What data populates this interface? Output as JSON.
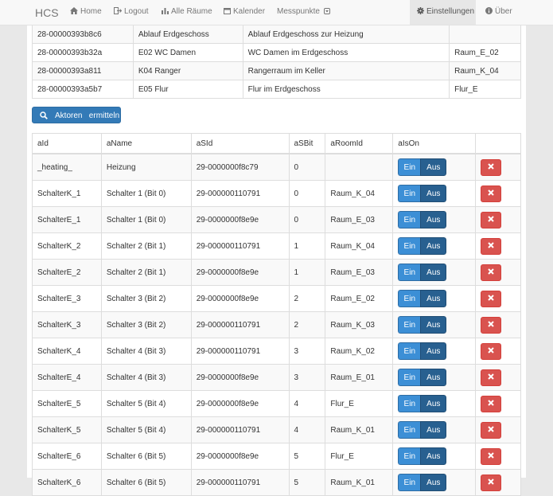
{
  "navbar": {
    "brand": "HCS",
    "items": [
      {
        "label": "Home",
        "icon": "home-icon"
      },
      {
        "label": "Logout",
        "icon": "logout-icon"
      },
      {
        "label": "Alle Räume",
        "icon": "bar-chart-icon"
      },
      {
        "label": "Kalender",
        "icon": "calendar-icon"
      },
      {
        "label": "Messpunkte",
        "icon": "caret-down-icon"
      }
    ],
    "right_items": [
      {
        "label": "Einstellungen",
        "icon": "gear-icon",
        "active": true
      },
      {
        "label": "Über",
        "icon": "info-icon"
      }
    ]
  },
  "sensors": [
    {
      "id": "28-00000393b8c6",
      "name": "Ablauf Erdgeschoss",
      "description": "Ablauf Erdgeschoss zur Heizung",
      "room": ""
    },
    {
      "id": "28-00000393b32a",
      "name": "E02 WC Damen",
      "description": "WC Damen im Erdgeschoss",
      "room": "Raum_E_02"
    },
    {
      "id": "28-00000393a811",
      "name": "K04 Ranger",
      "description": "Rangerraum im Keller",
      "room": "Raum_K_04"
    },
    {
      "id": "28-00000393a5b7",
      "name": "E05 Flur",
      "description": "Flur im Erdgeschoss",
      "room": "Flur_E"
    }
  ],
  "aktoren_button": {
    "label": "Aktoren   ermitteln",
    "icon": "search-icon"
  },
  "actor_table": {
    "headers": [
      "aId",
      "aName",
      "aSId",
      "aSBit",
      "aRoomId",
      "aIsOn",
      ""
    ],
    "on_label": "Ein",
    "off_label": "Aus",
    "rows": [
      {
        "aId": "_heating_",
        "aName": "Heizung",
        "aSId": "29-0000000f8c79",
        "aSBit": "0",
        "aRoomId": ""
      },
      {
        "aId": "SchalterK_1",
        "aName": "Schalter 1 (Bit 0)",
        "aSId": "29-000000110791",
        "aSBit": "0",
        "aRoomId": "Raum_K_04"
      },
      {
        "aId": "SchalterE_1",
        "aName": "Schalter 1 (Bit 0)",
        "aSId": "29-0000000f8e9e",
        "aSBit": "0",
        "aRoomId": "Raum_E_03"
      },
      {
        "aId": "SchalterK_2",
        "aName": "Schalter 2 (Bit 1)",
        "aSId": "29-000000110791",
        "aSBit": "1",
        "aRoomId": "Raum_K_04"
      },
      {
        "aId": "SchalterE_2",
        "aName": "Schalter 2 (Bit 1)",
        "aSId": "29-0000000f8e9e",
        "aSBit": "1",
        "aRoomId": "Raum_E_03"
      },
      {
        "aId": "SchalterE_3",
        "aName": "Schalter 3 (Bit 2)",
        "aSId": "29-0000000f8e9e",
        "aSBit": "2",
        "aRoomId": "Raum_E_02"
      },
      {
        "aId": "SchalterK_3",
        "aName": "Schalter 3 (Bit 2)",
        "aSId": "29-000000110791",
        "aSBit": "2",
        "aRoomId": "Raum_K_03"
      },
      {
        "aId": "SchalterK_4",
        "aName": "Schalter 4 (Bit 3)",
        "aSId": "29-000000110791",
        "aSBit": "3",
        "aRoomId": "Raum_K_02"
      },
      {
        "aId": "SchalterE_4",
        "aName": "Schalter 4 (Bit 3)",
        "aSId": "29-0000000f8e9e",
        "aSBit": "3",
        "aRoomId": "Raum_E_01"
      },
      {
        "aId": "SchalterE_5",
        "aName": "Schalter 5 (Bit 4)",
        "aSId": "29-0000000f8e9e",
        "aSBit": "4",
        "aRoomId": "Flur_E"
      },
      {
        "aId": "SchalterK_5",
        "aName": "Schalter 5 (Bit 4)",
        "aSId": "29-000000110791",
        "aSBit": "4",
        "aRoomId": "Raum_K_01"
      },
      {
        "aId": "SchalterE_6",
        "aName": "Schalter 6 (Bit 5)",
        "aSId": "29-0000000f8e9e",
        "aSBit": "5",
        "aRoomId": "Flur_E"
      },
      {
        "aId": "SchalterK_6",
        "aName": "Schalter 6 (Bit 5)",
        "aSId": "29-000000110791",
        "aSBit": "5",
        "aRoomId": "Raum_K_01"
      }
    ]
  },
  "colors": {
    "primary": "#337ab7",
    "danger": "#d9534f"
  }
}
